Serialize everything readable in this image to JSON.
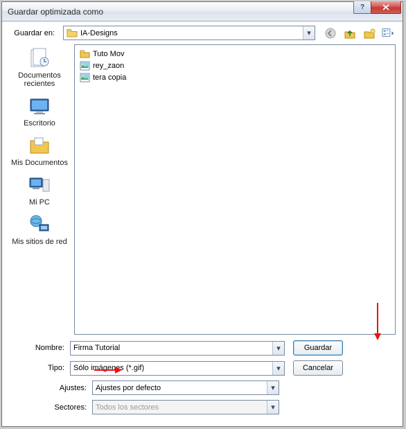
{
  "title": "Guardar optimizada como",
  "toprow": {
    "label": "Guardar en:",
    "location": "IA-Designs"
  },
  "toolbar_icons": [
    "back-icon",
    "up-icon",
    "new-folder-icon",
    "views-icon"
  ],
  "places": [
    {
      "label": "Documentos recientes"
    },
    {
      "label": "Escritorio"
    },
    {
      "label": "Mis Documentos"
    },
    {
      "label": "Mi PC"
    },
    {
      "label": "Mis sitios de red"
    }
  ],
  "files": [
    {
      "name": "Tuto Mov",
      "type": "folder"
    },
    {
      "name": "rey_zaon",
      "type": "image"
    },
    {
      "name": "tera copia",
      "type": "image"
    }
  ],
  "bottom": {
    "name_label": "Nombre:",
    "name_value": "Firma Tutorial",
    "type_label": "Tipo:",
    "type_value": "Sólo imágenes (*.gif)",
    "ajustes_label": "Ajustes:",
    "ajustes_value": "Ajustes por defecto",
    "sectores_label": "Sectores:",
    "sectores_value": "Todos los sectores"
  },
  "buttons": {
    "save": "Guardar",
    "cancel": "Cancelar"
  }
}
